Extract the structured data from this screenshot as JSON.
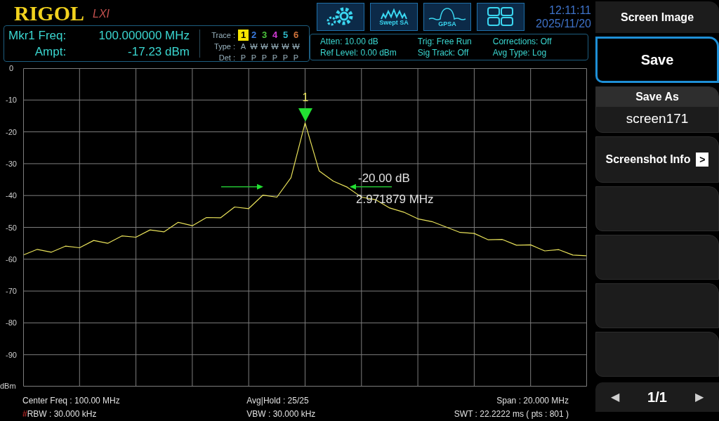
{
  "header": {
    "logo": "RIGOL",
    "lxi": "LXI",
    "mode_buttons": [
      {
        "kind": "settings"
      },
      {
        "kind": "swept",
        "label": "Swept SA"
      },
      {
        "kind": "gpsa",
        "label": "GPSA"
      },
      {
        "kind": "layout"
      }
    ],
    "time": "12:11:11",
    "date": "2025/11/20"
  },
  "marker": {
    "freq_label": "Mkr1 Freq:",
    "freq": "100.000000 MHz",
    "ampt_label": "Ampt:",
    "ampt": "-17.23 dBm"
  },
  "traces": {
    "trace_label": "Trace :",
    "type_label": "Type :",
    "det_label": "Det :",
    "items": [
      {
        "number": "1",
        "color": "#f5e400",
        "selected": true,
        "type": "A",
        "blanked": false,
        "det": "P"
      },
      {
        "number": "2",
        "color": "#3a7be0",
        "selected": false,
        "type": "W",
        "blanked": true,
        "det": "P"
      },
      {
        "number": "3",
        "color": "#4cc43c",
        "selected": false,
        "type": "W",
        "blanked": true,
        "det": "P"
      },
      {
        "number": "4",
        "color": "#d23ad6",
        "selected": false,
        "type": "W",
        "blanked": true,
        "det": "P"
      },
      {
        "number": "5",
        "color": "#2fb8c8",
        "selected": false,
        "type": "W",
        "blanked": true,
        "det": "P"
      },
      {
        "number": "6",
        "color": "#d2733a",
        "selected": false,
        "type": "W",
        "blanked": true,
        "det": "P"
      }
    ]
  },
  "settings": [
    [
      "Atten: 10.00 dB",
      "Ref Level: 0.00 dBm"
    ],
    [
      "Trig: Free Run",
      "Sig Track: Off"
    ],
    [
      "Corrections: Off",
      "Avg Type: Log"
    ]
  ],
  "plot": {
    "chart_data": {
      "type": "line",
      "grid": true,
      "ylabel": "dBm",
      "ylim": [
        -100,
        0
      ],
      "yticks": [
        {
          "value": 0,
          "label": "0"
        },
        {
          "value": -10,
          "label": "-10"
        },
        {
          "value": -20,
          "label": "-20"
        },
        {
          "value": -30,
          "label": "-30"
        },
        {
          "value": -40,
          "label": "-40"
        },
        {
          "value": -50,
          "label": "-50"
        },
        {
          "value": -60,
          "label": "-60"
        },
        {
          "value": -70,
          "label": "-70"
        },
        {
          "value": -80,
          "label": "-80"
        },
        {
          "value": -90,
          "label": "-90"
        }
      ],
      "categories": [
        null,
        null,
        null,
        null,
        null,
        null,
        null,
        null,
        null,
        null,
        null,
        null,
        null,
        null,
        null,
        null,
        null,
        null,
        null,
        null,
        null,
        null,
        null,
        null,
        null,
        null,
        null,
        null,
        null,
        null,
        null,
        null,
        null,
        null,
        null,
        null,
        null,
        null,
        null,
        null,
        null
      ],
      "series": [
        {
          "color": "#e9e25a",
          "values": [
            -58.6,
            -56.9,
            -57.8,
            -55.9,
            -56.4,
            -54.1,
            -55.0,
            -52.7,
            -53.1,
            -50.8,
            -51.4,
            -48.4,
            -49.5,
            -46.9,
            -47.0,
            -43.6,
            -44.1,
            -39.9,
            -40.5,
            -34.4,
            -17.2,
            -32.3,
            -35.5,
            -37.4,
            -40.5,
            -41.3,
            -43.9,
            -45.2,
            -47.3,
            -48.2,
            -49.9,
            -51.6,
            -51.9,
            -53.9,
            -53.8,
            -55.6,
            -55.5,
            -57.4,
            -57.0,
            -58.7,
            -58.9
          ]
        }
      ]
    },
    "marker_number": "1",
    "ndb_value": "-20.00 dB",
    "ndb_bandwidth": "2.971879 MHz"
  },
  "status": {
    "center": "Center Freq : 100.00 MHz",
    "rbw_flag": "#",
    "rbw": "RBW : 30.000 kHz",
    "avg_hold": "Avg|Hold : 25/25",
    "vbw": "VBW : 30.000 kHz",
    "span": "Span : 20.000 MHz",
    "swt": "SWT : 22.2222 ms ( pts : 801 )"
  },
  "softkeys": {
    "title": "Screen Image",
    "keys": [
      {
        "kind": "button",
        "label": "Save",
        "selected": true
      },
      {
        "kind": "value",
        "label": "Save As",
        "value": "screen171",
        "selected": false
      },
      {
        "kind": "submenu",
        "label": "Screenshot Info",
        "arrow": ">",
        "selected": false
      },
      {
        "kind": "empty",
        "selected": false
      },
      {
        "kind": "empty",
        "selected": false
      },
      {
        "kind": "empty",
        "selected": false
      },
      {
        "kind": "empty",
        "selected": false
      }
    ],
    "page": "1/1",
    "prev": "◀",
    "next": "▶"
  }
}
